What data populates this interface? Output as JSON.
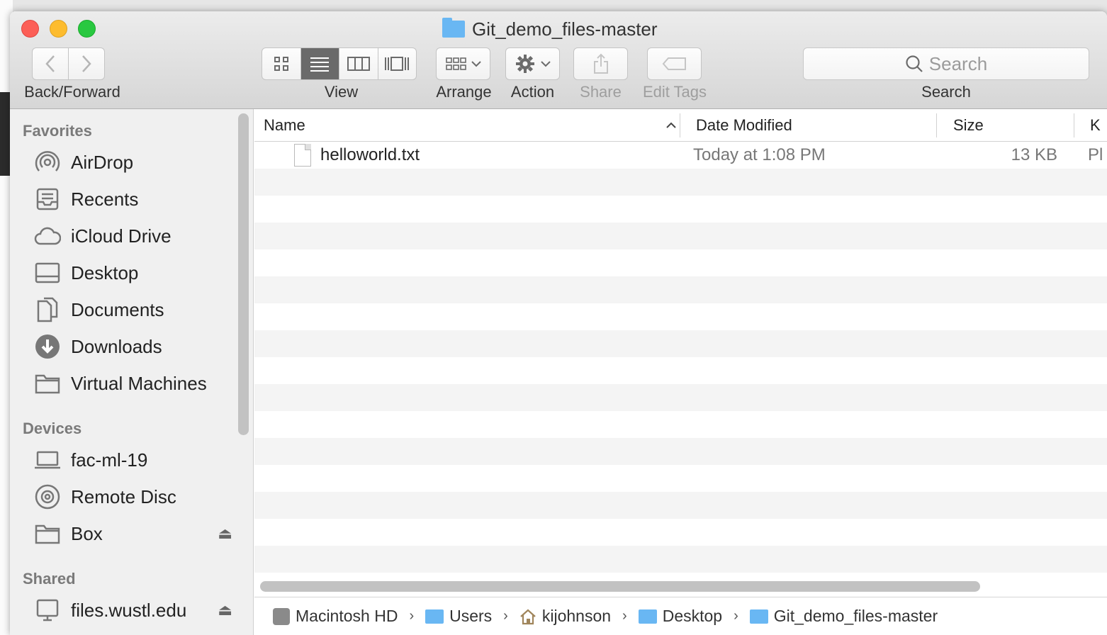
{
  "window": {
    "title": "Git_demo_files-master"
  },
  "toolbar": {
    "nav_label": "Back/Forward",
    "view_label": "View",
    "arrange_label": "Arrange",
    "action_label": "Action",
    "share_label": "Share",
    "edit_tags_label": "Edit Tags",
    "search_placeholder": "Search",
    "search_label": "Search"
  },
  "sidebar": {
    "favorites_heading": "Favorites",
    "favorites": [
      {
        "label": "AirDrop",
        "icon": "airdrop-icon"
      },
      {
        "label": "Recents",
        "icon": "recents-icon"
      },
      {
        "label": "iCloud Drive",
        "icon": "cloud-icon"
      },
      {
        "label": "Desktop",
        "icon": "desktop-icon"
      },
      {
        "label": "Documents",
        "icon": "documents-icon"
      },
      {
        "label": "Downloads",
        "icon": "downloads-icon"
      },
      {
        "label": "Virtual Machines",
        "icon": "folder-icon"
      }
    ],
    "devices_heading": "Devices",
    "devices": [
      {
        "label": "fac-ml-19",
        "icon": "laptop-icon"
      },
      {
        "label": "Remote Disc",
        "icon": "disc-icon"
      },
      {
        "label": "Box",
        "icon": "folder-icon"
      }
    ],
    "shared_heading": "Shared",
    "shared": [
      {
        "label": "files.wustl.edu",
        "icon": "server-icon"
      }
    ]
  },
  "columns": {
    "name": "Name",
    "date_modified": "Date Modified",
    "size": "Size",
    "kind": "K"
  },
  "files": [
    {
      "name": "helloworld.txt",
      "date_modified": "Today at 1:08 PM",
      "size": "13 KB",
      "kind": "Pl"
    }
  ],
  "pathbar": {
    "crumbs": [
      "Macintosh HD",
      "Users",
      "kijohnson",
      "Desktop",
      "Git_demo_files-master"
    ]
  }
}
